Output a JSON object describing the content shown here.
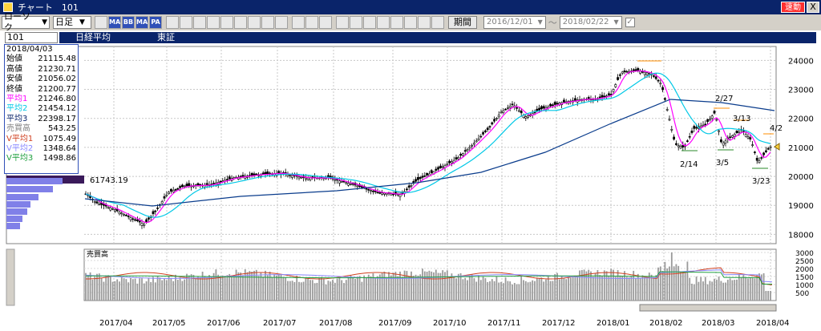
{
  "window": {
    "title": "チャート　101",
    "live_label": "速動",
    "close_label": "X"
  },
  "toolbar": {
    "type_select": "ローソク",
    "period_select": "日足",
    "icons": [
      "chart-icon",
      "ma-icon",
      "bb-icon",
      "mae-icon",
      "pa-icon",
      "cursor-icon",
      "zoom-in-icon",
      "zoom-out-icon",
      "search-icon",
      "trend-icon",
      "pen-icon",
      "eraser-icon",
      "text-icon",
      "line-icon",
      "light-icon",
      "copy-icon",
      "print-icon",
      "grid1-icon",
      "grid2-icon",
      "grid3-icon",
      "grid4-icon",
      "save-icon",
      "settings-icon",
      "calc-icon",
      "reset-icon"
    ],
    "icon_labels": [
      "",
      "MA",
      "BB",
      "MAE",
      "PA",
      "",
      "",
      "",
      "",
      "",
      "",
      "",
      "",
      "",
      "",
      "",
      "",
      "",
      "",
      "",
      "",
      "",
      "",
      "",
      ""
    ],
    "period_button": "期間",
    "date_from": "2016/12/01",
    "date_to": "2018/02/22",
    "tilde": "〜"
  },
  "header": {
    "code": "101",
    "name": "日経平均",
    "market": "東証"
  },
  "info": {
    "date": "2018/04/03",
    "rows": [
      {
        "label": "始値",
        "value": "21115.48",
        "color": "#000000"
      },
      {
        "label": "高値",
        "value": "21230.71",
        "color": "#000000"
      },
      {
        "label": "安値",
        "value": "21056.02",
        "color": "#000000"
      },
      {
        "label": "終値",
        "value": "21200.77",
        "color": "#000000"
      },
      {
        "label": "平均1",
        "value": "21246.80",
        "color": "#ff00ff"
      },
      {
        "label": "平均2",
        "value": "21454.12",
        "color": "#00c8e6"
      },
      {
        "label": "平均3",
        "value": "22398.17",
        "color": "#0a246a"
      },
      {
        "label": "売買高",
        "value": "543.25",
        "color": "#808080"
      },
      {
        "label": "V平均1",
        "value": "1075.49",
        "color": "#d04020"
      },
      {
        "label": "V平均2",
        "value": "1348.64",
        "color": "#8888ff"
      },
      {
        "label": "V平均3",
        "value": "1498.86",
        "color": "#20a040"
      }
    ]
  },
  "price_axis": [
    "24000",
    "23000",
    "22000",
    "21000",
    "20000",
    "19000",
    "18000"
  ],
  "volume_axis": [
    "3000",
    "2500",
    "2000",
    "1500",
    "1000",
    "500"
  ],
  "volume_label": "売買高",
  "x_axis": [
    "2017/04",
    "2017/05",
    "2017/06",
    "2017/07",
    "2017/08",
    "2017/09",
    "2017/10",
    "2017/11",
    "2017/12",
    "2018/01",
    "2018/02",
    "2018/03",
    "2018/04"
  ],
  "annotations": [
    {
      "text": "61743.19"
    },
    {
      "text": "2/27"
    },
    {
      "text": "3/13"
    },
    {
      "text": "4/2"
    },
    {
      "text": "2/14"
    },
    {
      "text": "3/5"
    },
    {
      "text": "3/23"
    }
  ]
}
